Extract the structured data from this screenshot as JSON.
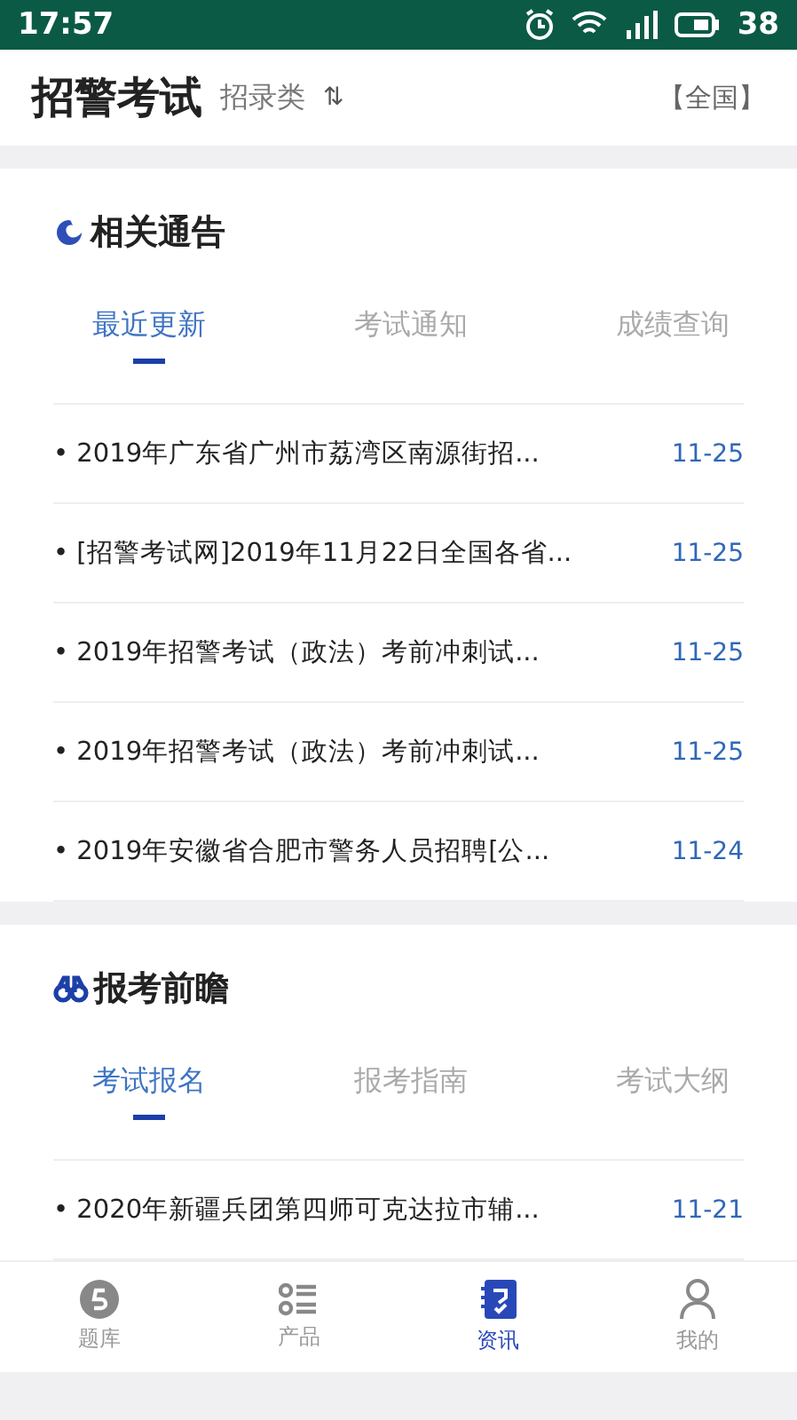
{
  "status_bar": {
    "time": "17:57",
    "battery": "38"
  },
  "header": {
    "title": "招警考试",
    "category": "招录类",
    "sort_icon": "⇅",
    "region": "【全国】"
  },
  "sections": [
    {
      "title": "相关通告",
      "tabs": [
        {
          "label": "最近更新",
          "selected": true
        },
        {
          "label": "考试通知",
          "selected": false
        },
        {
          "label": "成绩查询",
          "selected": false
        }
      ],
      "items": [
        {
          "title": "• 2019年广东省广州市荔湾区南源街招...",
          "date": "11-25"
        },
        {
          "title": "• [招警考试网]2019年11月22日全国各省...",
          "date": "11-25"
        },
        {
          "title": "• 2019年招警考试（政法）考前冲刺试...",
          "date": "11-25"
        },
        {
          "title": "• 2019年招警考试（政法）考前冲刺试...",
          "date": "11-25"
        },
        {
          "title": "• 2019年安徽省合肥市警务人员招聘[公...",
          "date": "11-24"
        }
      ]
    },
    {
      "title": "报考前瞻",
      "tabs": [
        {
          "label": "考试报名",
          "selected": true
        },
        {
          "label": "报考指南",
          "selected": false
        },
        {
          "label": "考试大纲",
          "selected": false
        }
      ],
      "items": [
        {
          "title": "• 2020年新疆兵团第四师可克达拉市辅...",
          "date": "11-21"
        }
      ]
    }
  ],
  "nav": [
    {
      "label": "题库",
      "selected": false
    },
    {
      "label": "产品",
      "selected": false
    },
    {
      "label": "资讯",
      "selected": true
    },
    {
      "label": "我的",
      "selected": false
    }
  ]
}
